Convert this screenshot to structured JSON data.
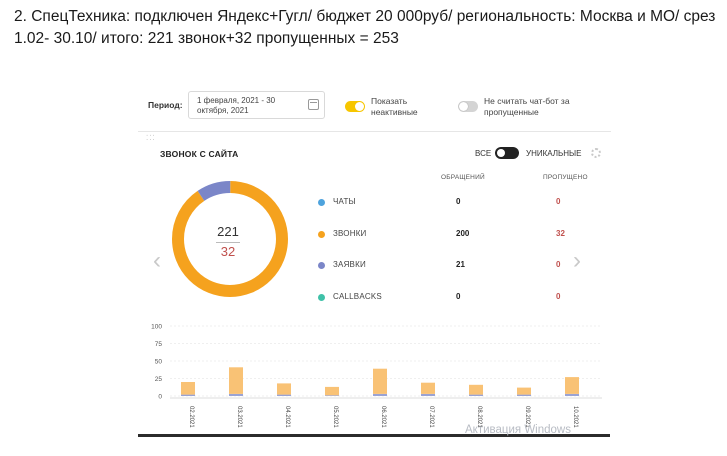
{
  "caption": "2. СпецТехника: подключен Яндекс+Гугл/ бюджет 20 000руб/ региональность: Москва и МО/ срез 1.02- 30.10/ итого: 221 звонок+32 пропущенных = 253",
  "filters": {
    "period_label": "Период:",
    "period_value": "1 февраля, 2021 - 30 октября, 2021",
    "show_inactive_label": "Показать неактивные",
    "show_inactive_on": true,
    "exclude_chatbot_label": "Не считать чат-бот за пропущенные",
    "exclude_chatbot_on": false
  },
  "card": {
    "title": "ЗВОНОК С САЙТА",
    "switch_left": "ВСЕ",
    "switch_right": "УНИКАЛЬНЫЕ",
    "col_requests": "ОБРАЩЕНИЙ",
    "col_missed": "ПРОПУЩЕНО",
    "donut_total": "221",
    "donut_missed": "32",
    "rows": [
      {
        "label": "ЧАТЫ",
        "requests": "0",
        "missed": "0",
        "color": "#4ea3dd"
      },
      {
        "label": "ЗВОНКИ",
        "requests": "200",
        "missed": "32",
        "color": "#f5a21e"
      },
      {
        "label": "ЗАЯВКИ",
        "requests": "21",
        "missed": "0",
        "color": "#7b86c8"
      },
      {
        "label": "CALLBACKS",
        "requests": "0",
        "missed": "0",
        "color": "#3fc1a8"
      }
    ]
  },
  "chart_data": {
    "type": "bar",
    "categories": [
      "02.2021",
      "03.2021",
      "04.2021",
      "05.2021",
      "06.2021",
      "07.2021",
      "08.2021",
      "09.2021",
      "10.2021"
    ],
    "series": [
      {
        "name": "ЗВОНКИ",
        "values": [
          18,
          38,
          16,
          12,
          36,
          16,
          14,
          10,
          24
        ]
      },
      {
        "name": "ЗАЯВКИ",
        "values": [
          2,
          3,
          2,
          1,
          3,
          3,
          2,
          2,
          3
        ]
      }
    ],
    "y_ticks": [
      "100",
      "75",
      "50",
      "25",
      "0"
    ],
    "ylim": [
      0,
      100
    ],
    "grid": true,
    "colors": [
      "#f9c275",
      "#9aa3d4"
    ]
  },
  "donut_data": {
    "values": [
      0,
      200,
      21,
      0
    ],
    "colors": [
      "#4ea3dd",
      "#f5a21e",
      "#7b86c8",
      "#3fc1a8"
    ]
  },
  "watermark": "Активация Windows"
}
